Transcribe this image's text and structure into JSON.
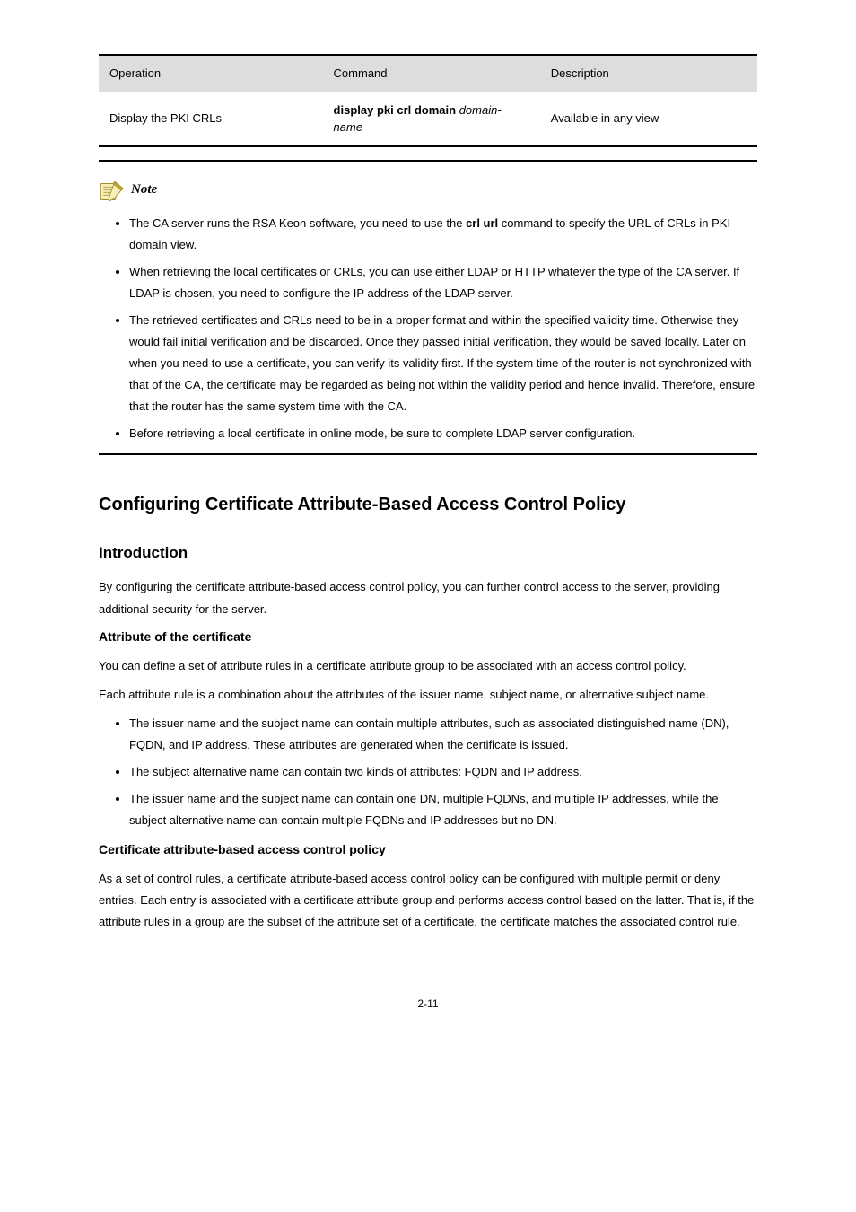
{
  "table": {
    "headers": [
      "Operation",
      "Command",
      "Description"
    ],
    "rows": [
      [
        "Display the PKI CRLs",
        {
          "parts": [
            "display pki crl domain ",
            "domain-name"
          ]
        },
        "Available in any view"
      ]
    ]
  },
  "note": {
    "label": "Note",
    "items": [
      {
        "parts": [
          "The CA server runs the RSA Keon software, you need to use the ",
          "crl url ",
          "command to specify the URL of CRLs in PKI domain view."
        ]
      },
      {
        "parts": [
          "When retrieving the local certificates or CRLs, you can use either LDAP or HTTP whatever the type of the CA server. If LDAP is chosen, you need to configure the IP address of the LDAP server."
        ]
      },
      {
        "parts": [
          "The retrieved certificates and CRLs need to be in a proper format and within the specified validity time. Otherwise they would fail initial verification and be discarded. Once they passed initial verification, they would be saved locally. Later on when you need to use a certificate, you can verify its validity first. If the system time of the router is not synchronized with that of the CA, the certificate may be regarded as being not within the validity period and hence invalid. Therefore, ensure that the router has the same system time with the CA."
        ]
      },
      {
        "parts": [
          "Before retrieving a local certificate in online mode, be sure to complete LDAP server configuration."
        ]
      }
    ]
  },
  "section": {
    "title": "Configuring Certificate Attribute-Based Access Control Policy"
  },
  "subsection": {
    "title": "Introduction"
  },
  "intro_p1": "By configuring the certificate attribute-based access control policy, you can further control access to the server, providing additional security for the server.",
  "subsub1": {
    "title": "Attribute of the certificate"
  },
  "subsub1_p1": "You can define a set of attribute rules in a certificate attribute group to be associated with an access control policy.",
  "subsub1_p2": "Each attribute rule is a combination about the attributes of the issuer name, subject name, or alternative subject name.",
  "attr_list": {
    "items": [
      "The issuer name and the subject name can contain multiple attributes, such as associated distinguished name (DN), FQDN, and IP address. These attributes are generated when the certificate is issued.",
      "The subject alternative name can contain two kinds of attributes: FQDN and IP address.",
      "The issuer name and the subject name can contain one DN, multiple FQDNs, and multiple IP addresses, while the subject alternative name can contain multiple FQDNs and IP addresses but no DN."
    ]
  },
  "subsub2": {
    "title": "Certificate attribute-based access control policy"
  },
  "subsub2_p1": "As a set of control rules, a certificate attribute-based access control policy can be configured with multiple permit or deny entries. Each entry is associated with a certificate attribute group and performs access control based on the latter. That is, if the attribute rules in a group are the subset of the attribute set of a certificate, the certificate matches the associated control rule.",
  "footer": {
    "page": "2-11"
  }
}
